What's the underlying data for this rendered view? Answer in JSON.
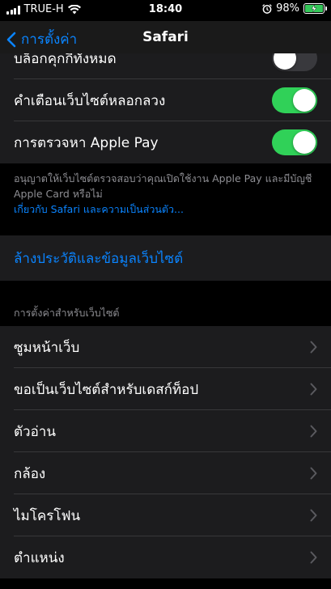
{
  "status_bar": {
    "carrier": "TRUE-H",
    "time": "18:40",
    "battery": "98%",
    "battery_level": 0.98,
    "icons": [
      "signal-icon",
      "wifi-icon",
      "alarm-icon",
      "battery-icon",
      "charging-bolt-icon"
    ],
    "battery_color": "#34c759"
  },
  "nav": {
    "back_label": "การตั้งค่า",
    "title": "Safari"
  },
  "privacy_group": {
    "rows": [
      {
        "label": "บล็อกคุกกี้ทั้งหมด",
        "toggle_on": false
      },
      {
        "label": "คำเตือนเว็บไซต์หลอกลวง",
        "toggle_on": true
      },
      {
        "label": "การตรวจหา Apple Pay",
        "toggle_on": true
      }
    ],
    "footer_text": "อนุญาตให้เว็บไซต์ตรวจสอบว่าคุณเปิดใช้งาน Apple Pay และมีบัญชี Apple Card หรือไม่",
    "footer_link": "เกี่ยวกับ Safari และความเป็นส่วนตัว..."
  },
  "clear_history": {
    "label": "ล้างประวัติและข้อมูลเว็บไซต์"
  },
  "website_settings": {
    "header": "การตั้งค่าสำหรับเว็บไซต์",
    "rows": [
      {
        "label": "ซูมหน้าเว็บ"
      },
      {
        "label": "ขอเป็นเว็บไซต์สำหรับเดสก์ท็อป"
      },
      {
        "label": "ตัวอ่าน"
      },
      {
        "label": "กล้อง"
      },
      {
        "label": "ไมโครโฟน"
      },
      {
        "label": "ตำแหน่ง"
      }
    ]
  },
  "colors": {
    "accent": "#0a84ff",
    "toggle_on": "#30d158",
    "toggle_off": "#39393d",
    "cell_bg": "#1c1c1e",
    "background": "#000000"
  }
}
